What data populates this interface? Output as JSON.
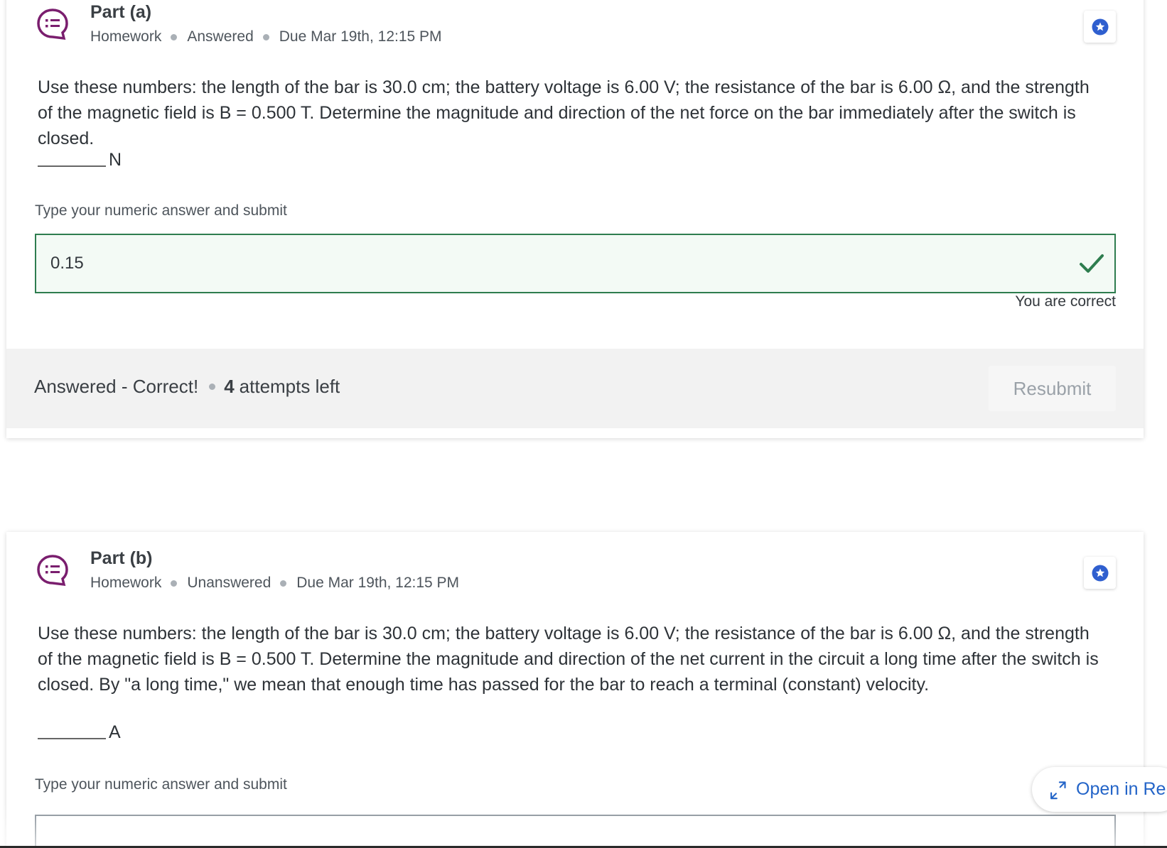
{
  "colors": {
    "accent_purple": "#7a1e6e",
    "correct_green": "#2e7d4f",
    "star_blue": "#2f5fcf",
    "link_blue": "#2364c8"
  },
  "part_a": {
    "title": "Part (a)",
    "meta": [
      "Homework",
      "Answered",
      "Due Mar 19th, 12:15 PM"
    ],
    "question": "Use these numbers: the length of the bar is 30.0 cm; the battery voltage is 6.00 V; the resistance of the bar is 6.00 Ω, and the strength of the magnetic field is B = 0.500 T. Determine the magnitude and direction of the net force on the bar immediately after the switch is closed.",
    "unit": "N",
    "prompt": "Type your numeric answer and submit",
    "answer_value": "0.15",
    "feedback": "You are correct",
    "status": "Answered - Correct!",
    "attempts_count": "4",
    "attempts_label": "attempts left",
    "resubmit_label": "Resubmit"
  },
  "part_b": {
    "title": "Part (b)",
    "meta": [
      "Homework",
      "Unanswered",
      "Due Mar 19th, 12:15 PM"
    ],
    "question": "Use these numbers: the length of the bar is 30.0 cm; the battery voltage is 6.00 V; the resistance of the bar is 6.00 Ω, and the strength of the magnetic field is B = 0.500 T. Determine the magnitude and direction of the net current in the circuit a long time after the switch is closed. By \"a long time,\" we mean that enough time has passed for the bar to reach a terminal (constant) velocity.",
    "unit": "A",
    "prompt": "Type your numeric answer and submit"
  },
  "open_button": {
    "label": "Open in Re"
  },
  "icons": {
    "question": "question-bubble-icon",
    "star": "star-icon",
    "check": "check-icon",
    "expand": "expand-icon"
  }
}
